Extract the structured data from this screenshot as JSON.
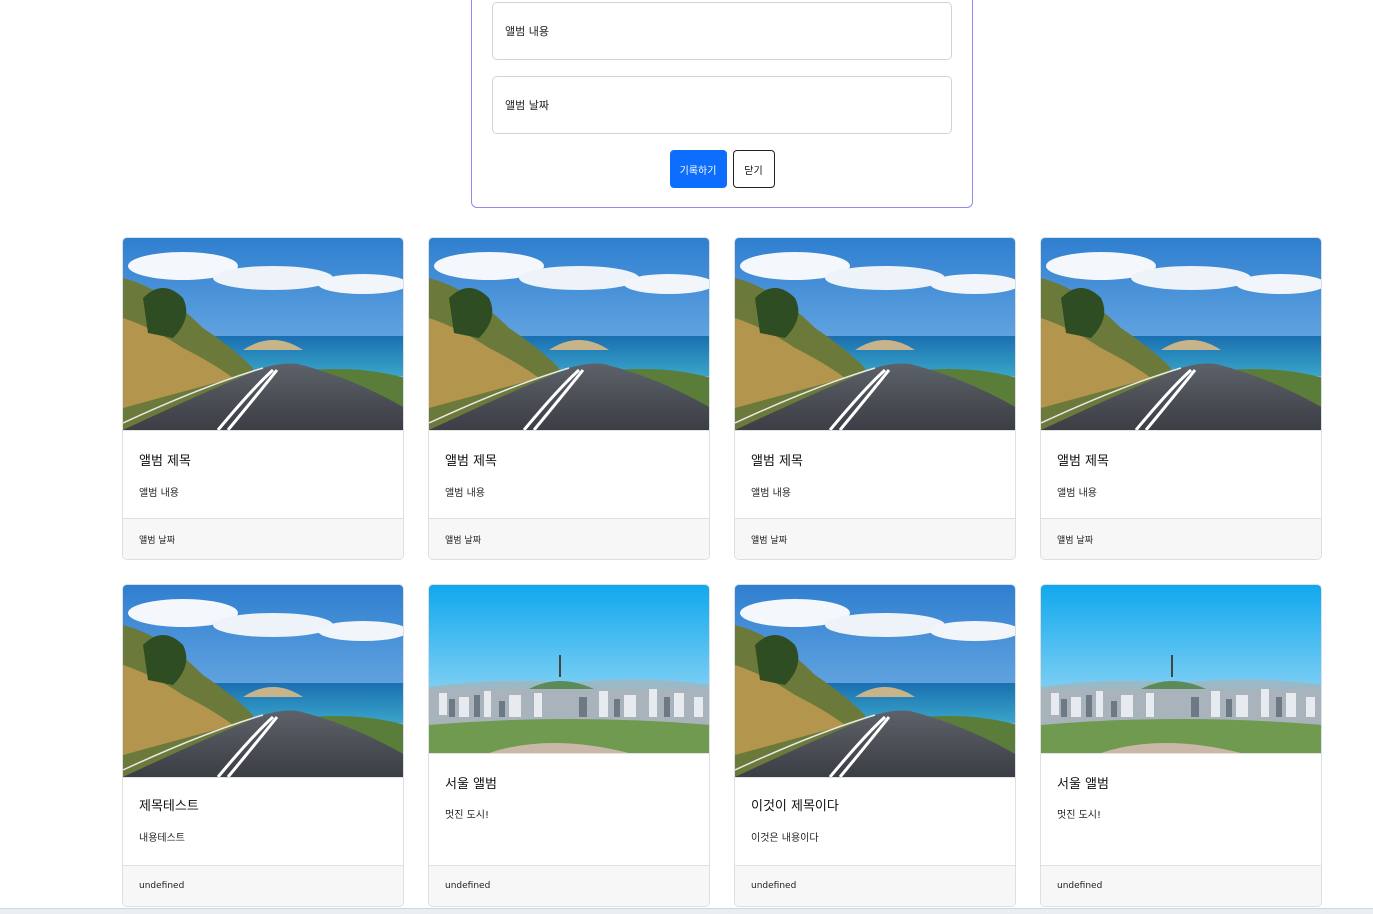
{
  "form": {
    "content_placeholder": "앨범 내용",
    "date_placeholder": "앨범 날짜",
    "submit_label": "기록하기",
    "close_label": "닫기"
  },
  "colors": {
    "primary": "#0d6efd",
    "panel_border": "#8e8cf0",
    "footer_bg": "#f7f7f7"
  },
  "cards": [
    {
      "image": "road",
      "title": "앨범 제목",
      "text": "앨범 내용",
      "footer": "앨범 날짜"
    },
    {
      "image": "road",
      "title": "앨범 제목",
      "text": "앨범 내용",
      "footer": "앨범 날짜"
    },
    {
      "image": "road",
      "title": "앨범 제목",
      "text": "앨범 내용",
      "footer": "앨범 날짜"
    },
    {
      "image": "road",
      "title": "앨범 제목",
      "text": "앨범 내용",
      "footer": "앨범 날짜"
    },
    {
      "image": "road",
      "title": "제목테스트",
      "text": "내용테스트",
      "footer": "undefined"
    },
    {
      "image": "city",
      "title": "서울 앨범",
      "text": "멋진 도시!",
      "footer": "undefined"
    },
    {
      "image": "road",
      "title": "이것이 제목이다",
      "text": "이것은 내용이다",
      "footer": "undefined"
    },
    {
      "image": "city",
      "title": "서울 앨범",
      "text": "멋진 도시!",
      "footer": "undefined"
    }
  ]
}
